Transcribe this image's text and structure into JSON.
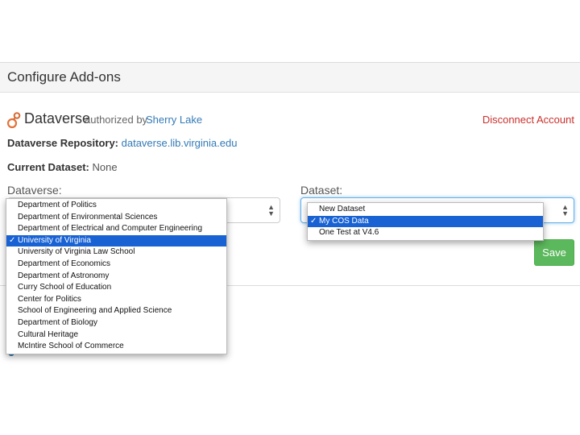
{
  "panel": {
    "title": "Configure Add-ons"
  },
  "addon": {
    "name": "Dataverse",
    "authorized_text": "authorized by",
    "user": "Sherry Lake",
    "disconnect_label": "Disconnect Account"
  },
  "repository": {
    "label": "Dataverse Repository:",
    "value": "dataverse.lib.virginia.edu"
  },
  "current_dataset": {
    "label": "Current Dataset:",
    "value": "None"
  },
  "dataverse_select": {
    "label": "Dataverse:",
    "selected_index": 3,
    "options": [
      "Department of Politics",
      "Department of Environmental Sciences",
      "Department of Electrical and Computer Engineering",
      "University of Virginia",
      "University of Virginia Law School",
      "Department of Economics",
      "Department of Astronomy",
      "Curry School of Education",
      "Center for Politics",
      "School of Engineering and Applied Science",
      "Department of Biology",
      "Cultural Heritage",
      "McIntire School of Commerce"
    ]
  },
  "dataset_select": {
    "label": "Dataset:",
    "selected_index": 1,
    "options": [
      "New Dataset",
      "My COS Data",
      "One Test at V4.6"
    ]
  },
  "save_label": "Save",
  "colors": {
    "link": "#337ab7",
    "save": "#5cb85c",
    "disconnect": "#c9302c",
    "selection": "#1862d3"
  }
}
